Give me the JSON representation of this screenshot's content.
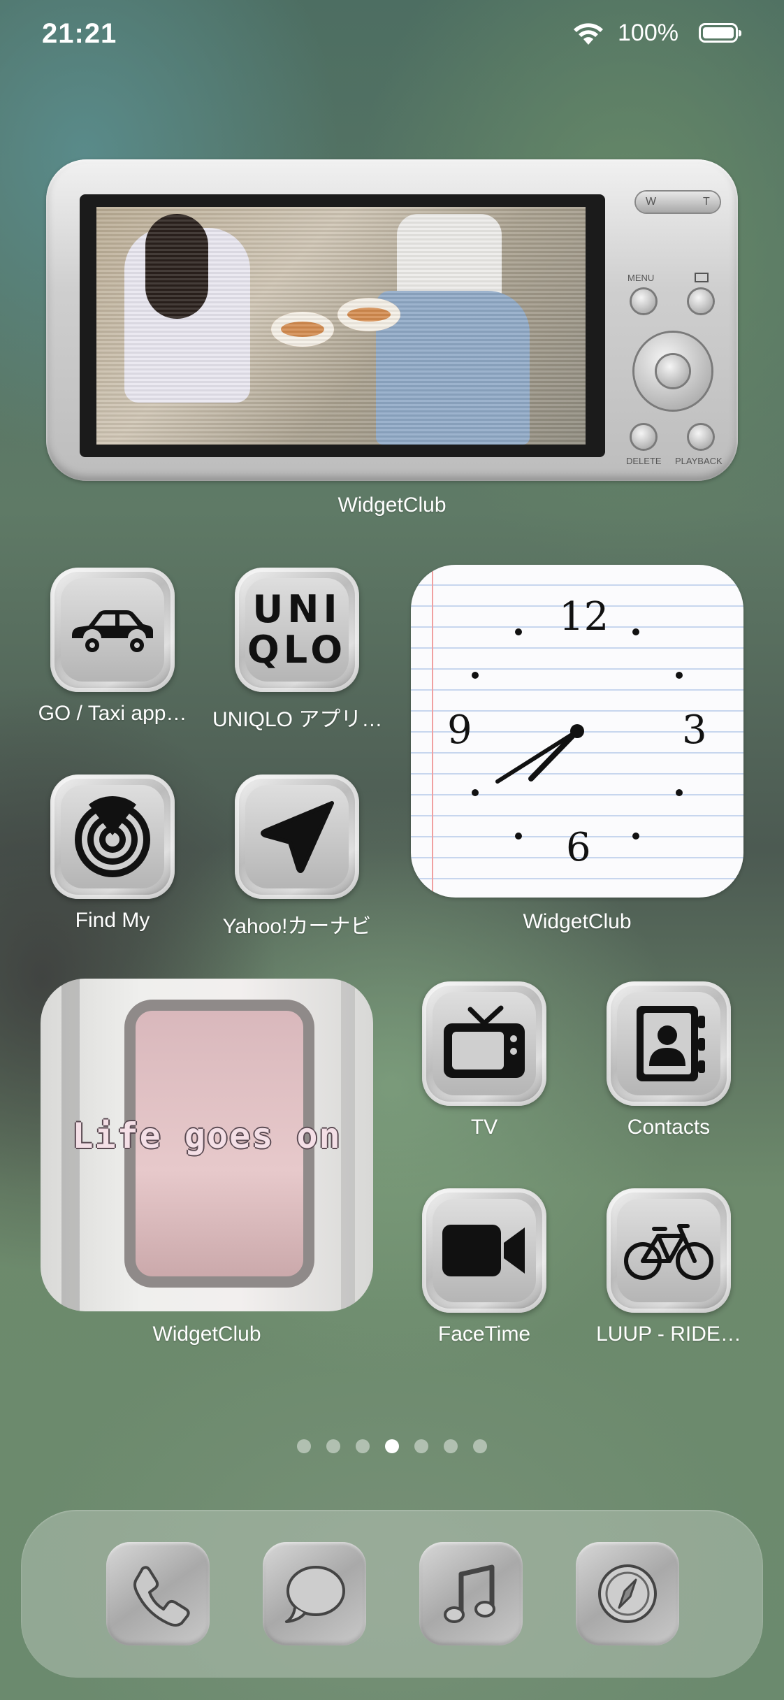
{
  "status_bar": {
    "time": "21:21",
    "battery_percent": "100%"
  },
  "widgets": {
    "camera": {
      "label": "WidgetClub",
      "buttons": {
        "w": "W",
        "t": "T",
        "menu": "MENU",
        "delete": "DELETE",
        "playback": "PLAYBACK"
      }
    },
    "clock": {
      "label": "WidgetClub",
      "numbers": {
        "n12": "12",
        "n3": "3",
        "n6": "6",
        "n9": "9"
      }
    },
    "life": {
      "label": "WidgetClub",
      "text": "Life goes on"
    }
  },
  "apps": {
    "go_taxi": {
      "label": "GO / Taxi app…",
      "icon": "car-icon"
    },
    "uniqlo": {
      "label": "UNIQLO アプリ…",
      "icon_text_line1": "UNI",
      "icon_text_line2": "QLO"
    },
    "find_my": {
      "label": "Find My",
      "icon": "radar-icon"
    },
    "yahoo_navi": {
      "label": "Yahoo!カーナビ",
      "icon": "navigation-arrow-icon"
    },
    "tv": {
      "label": "TV",
      "icon": "tv-icon"
    },
    "contacts": {
      "label": "Contacts",
      "icon": "contacts-book-icon"
    },
    "facetime": {
      "label": "FaceTime",
      "icon": "video-camera-icon"
    },
    "luup": {
      "label": "LUUP - RIDE…",
      "icon": "bicycle-icon"
    }
  },
  "page_dots": {
    "count": 7,
    "active_index": 3
  },
  "dock": [
    {
      "name": "phone",
      "icon": "phone-icon"
    },
    {
      "name": "messages",
      "icon": "chat-bubble-icon"
    },
    {
      "name": "music",
      "icon": "music-note-icon"
    },
    {
      "name": "safari",
      "icon": "compass-icon"
    }
  ],
  "colors": {
    "label_text": "#ffffff",
    "icon_glyph": "#111111"
  }
}
